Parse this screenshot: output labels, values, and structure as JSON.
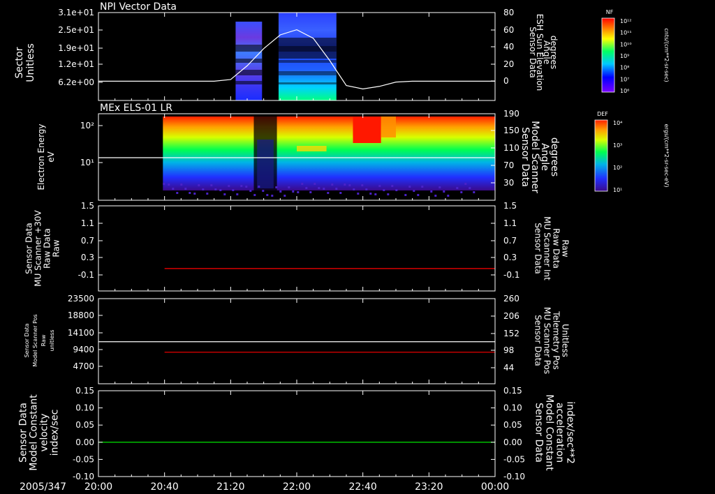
{
  "chart_data": [
    {
      "type": "heatmap",
      "title": "NPI Vector Data",
      "ylabel": [
        "Sector",
        "Unitless"
      ],
      "yticks": [
        "3.1e+01",
        "2.5e+01",
        "1.9e+01",
        "1.2e+01",
        "6.2e+00"
      ],
      "right_label": [
        "Sensor Data",
        "ESH Sun Elevation",
        "Angle",
        "degrees"
      ],
      "right_ticks": [
        "80",
        "60",
        "40",
        "20",
        "0"
      ],
      "right_ylim": [
        -20,
        80
      ],
      "colorbar": {
        "label": "NF",
        "unit": "cnts/(cm**2-sr-sec)",
        "ticks": [
          "10¹²",
          "10¹¹",
          "10¹⁰",
          "10⁹",
          "10⁸",
          "10⁷",
          "10⁶"
        ]
      },
      "overlay_line": {
        "color": "#ffffff",
        "x": [
          "20:00",
          "21:10",
          "21:20",
          "21:30",
          "21:40",
          "21:50",
          "22:00",
          "22:10",
          "22:20",
          "22:30",
          "22:40",
          "22:50",
          "23:00",
          "23:10",
          "00:00"
        ],
        "y": [
          0,
          0,
          2,
          18,
          38,
          54,
          60,
          50,
          24,
          -5,
          -9,
          -6,
          -1,
          0,
          0
        ]
      },
      "data_blocks": [
        {
          "x": [
            "21:23",
            "21:39"
          ]
        },
        {
          "x": [
            "21:49",
            "22:24"
          ]
        }
      ]
    },
    {
      "type": "heatmap",
      "title": "MEx ELS-01 LR",
      "ylabel": [
        "Electron Energy",
        "eV"
      ],
      "yticks": [
        "10²",
        "10¹"
      ],
      "right_label": [
        "Sensor Data",
        "Model Scanner",
        "Angle",
        "degrees"
      ],
      "right_ticks": [
        "190",
        "150",
        "110",
        "70",
        "30"
      ],
      "colorbar": {
        "label": "DEF",
        "unit": "ergs/(cm**2-sr-sec-eV)",
        "ticks": [
          "10⁴",
          "10³",
          "10²",
          "10¹"
        ]
      },
      "overlay_line": {
        "color": "#ffffff",
        "y": 90
      }
    },
    {
      "type": "line",
      "ylabel": [
        "Sensor Data",
        "MU Scanner +30V",
        "Raw Data",
        "Raw"
      ],
      "yticks": [
        "1.5",
        "1.1",
        "0.7",
        "0.3",
        "-0.1"
      ],
      "ylim": [
        -0.4,
        1.5
      ],
      "right_label": [
        "Sensor Data",
        "MU Scanner Int",
        "Raw Data",
        "Raw"
      ],
      "right_ticks": [
        "1.5",
        "1.1",
        "0.7",
        "0.3",
        "-0.1"
      ],
      "series": [
        {
          "color": "#ff0000",
          "x": [
            "20:40",
            "00:00"
          ],
          "y": [
            0.1,
            0.1
          ]
        }
      ]
    },
    {
      "type": "line",
      "ylabel": [
        "Sensor Data",
        "Model Scanner Pos",
        "Raw",
        "unitless"
      ],
      "yticks": [
        "23500",
        "18800",
        "14100",
        "9400",
        "4700"
      ],
      "ylim": [
        0,
        23500
      ],
      "right_label": [
        "Sensor Data",
        "MU Scanner Pos",
        "Telemetry Pos",
        "Unitless"
      ],
      "right_ticks": [
        "260",
        "206",
        "152",
        "98",
        "44"
      ],
      "series": [
        {
          "color": "#ffffff",
          "x": [
            "20:00",
            "00:00"
          ],
          "y": [
            11600,
            11600
          ]
        },
        {
          "color": "#ff0000",
          "x": [
            "20:40",
            "00:00"
          ],
          "y": [
            8700,
            8700
          ]
        }
      ]
    },
    {
      "type": "line",
      "ylabel": [
        "Sensor Data",
        "Model Constant",
        "velocity",
        "index/sec"
      ],
      "yticks": [
        "0.15",
        "0.10",
        "0.05",
        "0.00",
        "-0.05",
        "-0.10"
      ],
      "ylim": [
        -0.1,
        0.15
      ],
      "right_label": [
        "Sensor Data",
        "Model Constant",
        "acceleration",
        "index/sec**2"
      ],
      "right_ticks": [
        "0.15",
        "0.10",
        "0.05",
        "0.00",
        "-0.05",
        "-0.10"
      ],
      "series": [
        {
          "color": "#00ff00",
          "x": [
            "20:00",
            "00:00"
          ],
          "y": [
            0.0,
            0.0
          ]
        }
      ]
    }
  ],
  "xaxis": {
    "date": "2005/347",
    "ticks": [
      "20:00",
      "20:40",
      "21:20",
      "22:00",
      "22:40",
      "23:20",
      "00:00"
    ]
  }
}
